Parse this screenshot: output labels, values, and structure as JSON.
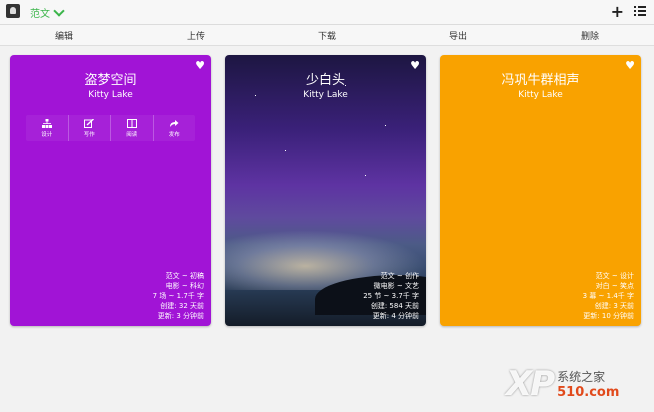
{
  "topbar": {
    "doc_switch_label": "范文",
    "add_label": "+"
  },
  "toolbar": {
    "edit": "编辑",
    "upload": "上传",
    "download": "下载",
    "export": "导出",
    "delete": "删除"
  },
  "cards": [
    {
      "title": "盗梦空间",
      "author": "Kitty Lake",
      "color": "#a114d6",
      "actions": {
        "design": "设计",
        "write": "写作",
        "read": "阅读",
        "publish": "发布"
      },
      "meta": {
        "genre": "范文 ~ 初稿",
        "category": "电影 ~ 科幻",
        "stats": "7 场 ~ 1.7千 字",
        "created": "创建: 32 天前",
        "updated": "更新: 3 分钟前"
      }
    },
    {
      "title": "少白头",
      "author": "Kitty Lake",
      "meta": {
        "genre": "范文 ~ 创作",
        "category": "微电影 ~ 文艺",
        "stats": "25 节 ~ 3.7千 字",
        "created": "创建: 584 天前",
        "updated": "更新: 4 分钟前"
      }
    },
    {
      "title": "冯巩牛群相声",
      "author": "Kitty Lake",
      "color": "#f9a200",
      "meta": {
        "genre": "范文 ~ 设计",
        "category": "对白 ~ 笑点",
        "stats": "3 幕 ~ 1.4千 字",
        "created": "创建: 3 天前",
        "updated": "更新: 10 分钟前"
      }
    }
  ],
  "watermark": {
    "logo": "XP",
    "line1": "系统之家",
    "line2": "510.com"
  }
}
